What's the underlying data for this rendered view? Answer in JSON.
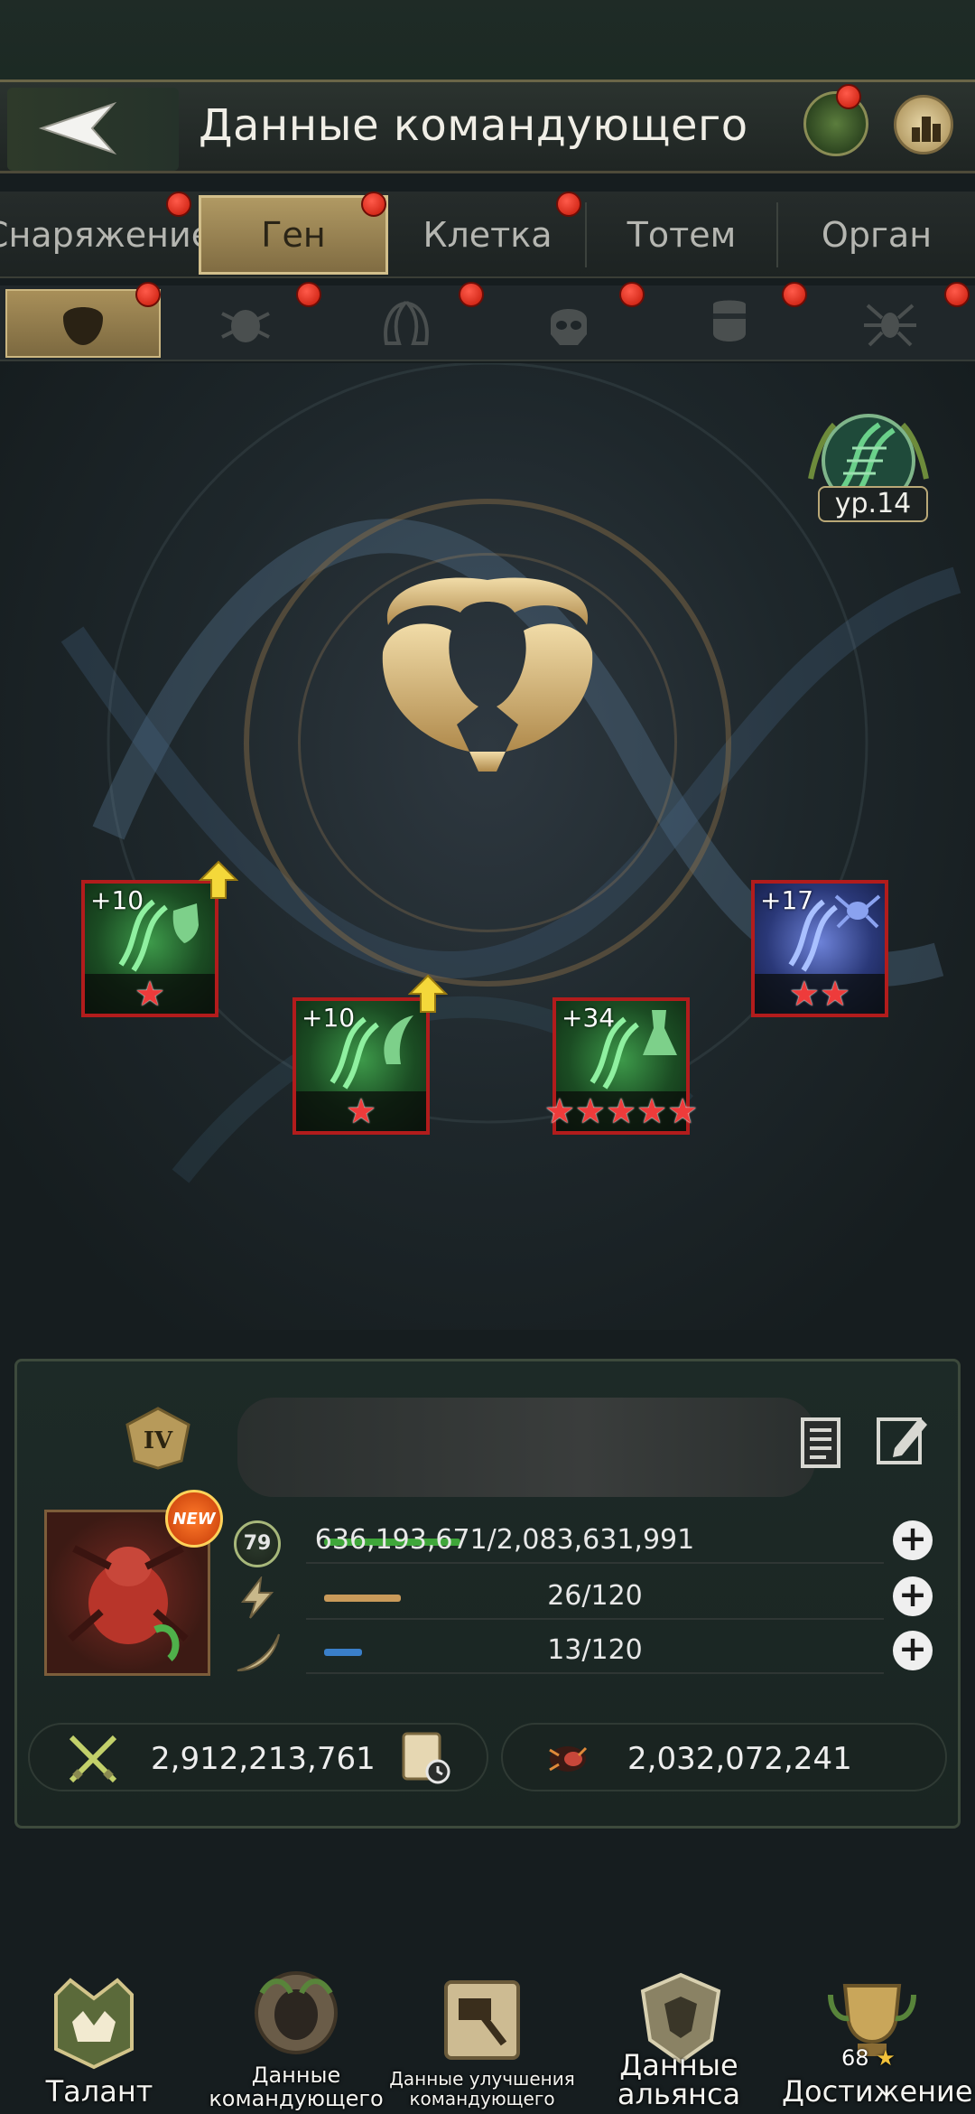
{
  "header": {
    "title": "Данные командующего",
    "back_icon": "back-arrow-icon",
    "gene_icon": "gene-icon",
    "rank_icon": "ranking-chart-icon"
  },
  "tabs": [
    {
      "label": "Снаряжение"
    },
    {
      "label": "Ген"
    },
    {
      "label": "Клетка"
    },
    {
      "label": "Тотем"
    },
    {
      "label": "Орган"
    }
  ],
  "active_tab": "Ген",
  "subtabs": [
    "ant-mask-icon",
    "beetle-icon",
    "mandibles-icon",
    "skull-icon",
    "shield-icon",
    "spider-icon"
  ],
  "level_badge": {
    "label": "ур.14"
  },
  "gene_cards": [
    {
      "plus": "+10",
      "stars": 1,
      "type": "shield",
      "color": "green",
      "upgrade": true
    },
    {
      "plus": "+10",
      "stars": 1,
      "type": "claw",
      "color": "green",
      "upgrade": true
    },
    {
      "plus": "+34",
      "stars": 5,
      "type": "flask",
      "color": "green",
      "upgrade": false
    },
    {
      "plus": "+17",
      "stars": 2,
      "type": "ant",
      "color": "blue",
      "upgrade": false
    }
  ],
  "commander": {
    "rank": "IV",
    "new_badge": "NEW",
    "level": "79",
    "hp": "636,193,671/2,083,631,991",
    "hp_fraction": 0.305,
    "energy": "26/120",
    "energy_fraction": 0.217,
    "stamina": "13/120",
    "stamina_fraction": 0.108,
    "power": "2,912,213,761",
    "kills": "2,032,072,241"
  },
  "bottom_nav": [
    {
      "label": "Талант"
    },
    {
      "label": "Данные командующего"
    },
    {
      "label": "Данные улучшения командующего"
    },
    {
      "label": "Данные альянса"
    },
    {
      "label": "Достижение",
      "badge": "68"
    }
  ],
  "colors": {
    "accent_gold": "#b09963",
    "hp_bar": "#3fa63a",
    "energy_bar": "#c99a5a",
    "stamina_bar": "#3a7fc9",
    "card_border": "#b21c1c"
  }
}
